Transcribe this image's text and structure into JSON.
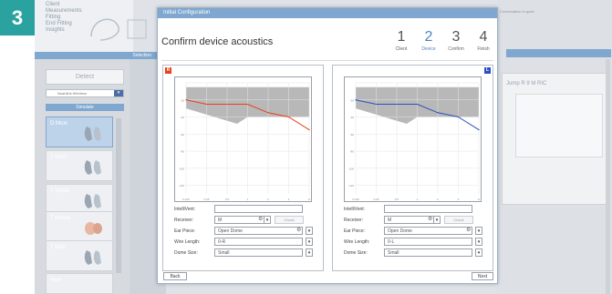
{
  "step_badge": "3",
  "background": {
    "nav_items": [
      "Client",
      "Measurements",
      "Fitting",
      "End Fitting",
      "Insights"
    ],
    "selection_label": "Selection",
    "detect_label": "Detect",
    "wireless_value": "Noahlink Wireless",
    "simulate_label": "Simulate",
    "devices": [
      "D Moxi",
      "T Moxi",
      "T Stride",
      "T Insera",
      "T Max",
      "Moxi"
    ],
    "right_card_title": "Jump R 9 M RIC",
    "right_top_text": "Conversation in quiet"
  },
  "dialog": {
    "title": "Initial Configuration",
    "heading": "Confirm device acoustics",
    "steps": [
      {
        "num": "1",
        "label": "Client"
      },
      {
        "num": "2",
        "label": "Device"
      },
      {
        "num": "3",
        "label": "Confirm"
      },
      {
        "num": "4",
        "label": "Finish"
      }
    ],
    "current_step": 2,
    "left": {
      "side": "R",
      "color": "#e8401c",
      "fields": {
        "intellivent_label": "IntelliVent:",
        "receiver_label": "Receiver:",
        "receiver_value": "M",
        "check_label": "Check",
        "ear_piece_label": "Ear Piece:",
        "ear_piece_value": "Open Dome",
        "wire_length_label": "Wire Length:",
        "wire_length_value": "0-R",
        "dome_size_label": "Dome Size:",
        "dome_size_value": "Small"
      }
    },
    "right": {
      "side": "L",
      "color": "#2d4fbf",
      "fields": {
        "intellivent_label": "IntelliVent:",
        "receiver_label": "Receiver:",
        "receiver_value": "M",
        "check_label": "Check",
        "ear_piece_label": "Ear Piece:",
        "ear_piece_value": "Open Dome",
        "wire_length_label": "Wire Length:",
        "wire_length_value": "0-L",
        "dome_size_label": "Dome Size:",
        "dome_size_value": "Small"
      }
    },
    "back_label": "Back",
    "next_label": "Next"
  },
  "chart_data": [
    {
      "type": "line",
      "series": [
        {
          "values": [
            -20,
            -25,
            -25,
            -25,
            -35,
            -40,
            -55
          ]
        }
      ],
      "x": [
        0.125,
        0.25,
        0.5,
        1,
        2,
        4,
        8
      ],
      "ylim": [
        0,
        130
      ],
      "xlim": [
        0.125,
        8
      ],
      "grid": true,
      "shaded_region": "gray upper band",
      "color": "#e8401c"
    },
    {
      "type": "line",
      "series": [
        {
          "values": [
            -20,
            -25,
            -25,
            -25,
            -35,
            -40,
            -55
          ]
        }
      ],
      "x": [
        0.125,
        0.25,
        0.5,
        1,
        2,
        4,
        8
      ],
      "ylim": [
        0,
        130
      ],
      "xlim": [
        0.125,
        8
      ],
      "grid": true,
      "shaded_region": "gray upper band",
      "color": "#2d4fbf"
    }
  ]
}
